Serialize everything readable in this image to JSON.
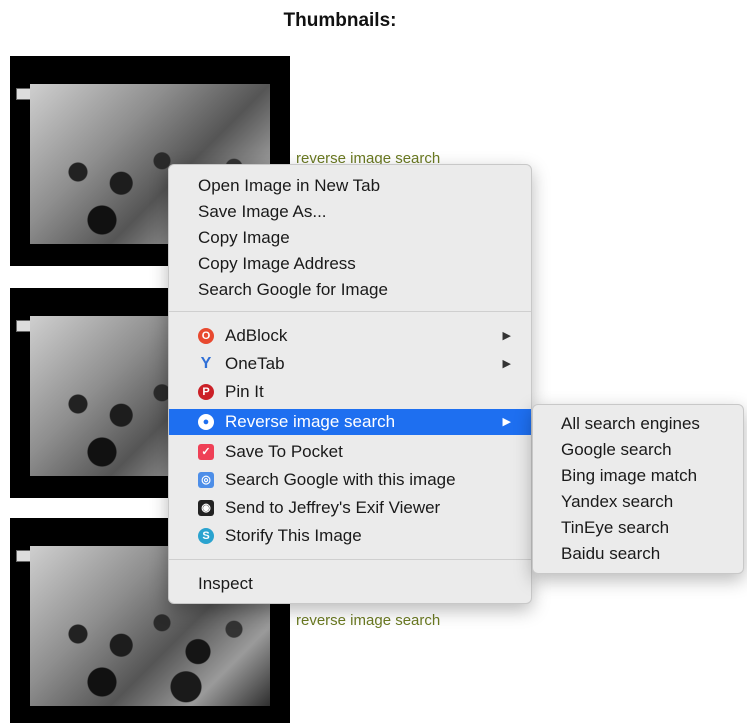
{
  "heading": "Thumbnails:",
  "links": {
    "reverse_image_search_1": "reverse image search",
    "reverse_image_search_2": "reverse image search"
  },
  "context_menu": {
    "items": [
      {
        "label": "Open Image in New Tab"
      },
      {
        "label": "Save Image As..."
      },
      {
        "label": "Copy Image"
      },
      {
        "label": "Copy Image Address"
      },
      {
        "label": "Search Google for Image"
      },
      {
        "label": "AdBlock",
        "icon": "adblock-icon",
        "icon_color": "#e8492f",
        "has_submenu": true
      },
      {
        "label": "OneTab",
        "icon": "onetab-icon",
        "icon_color": "#2f6fd6",
        "has_submenu": true
      },
      {
        "label": "Pin It",
        "icon": "pinterest-icon",
        "icon_color": "#cb2027"
      },
      {
        "label": "Reverse image search",
        "icon": "reverse-search-icon",
        "icon_color": "#3aa0d8",
        "has_submenu": true,
        "highlighted": true
      },
      {
        "label": "Save To Pocket",
        "icon": "pocket-icon",
        "icon_color": "#ef4056"
      },
      {
        "label": "Search Google with this image",
        "icon": "camera-icon",
        "icon_color": "#4d8ee8"
      },
      {
        "label": "Send to Jeffrey's Exif Viewer",
        "icon": "exif-camera-icon",
        "icon_color": "#222222"
      },
      {
        "label": "Storify This Image",
        "icon": "storify-icon",
        "icon_color": "#2aa3cf"
      },
      {
        "label": "Inspect"
      }
    ],
    "highlight_color": "#1e6ff0"
  },
  "submenu": {
    "items": [
      {
        "label": "All search engines"
      },
      {
        "label": "Google search"
      },
      {
        "label": "Bing image match"
      },
      {
        "label": "Yandex search"
      },
      {
        "label": "TinEye search"
      },
      {
        "label": "Baidu search"
      }
    ]
  }
}
